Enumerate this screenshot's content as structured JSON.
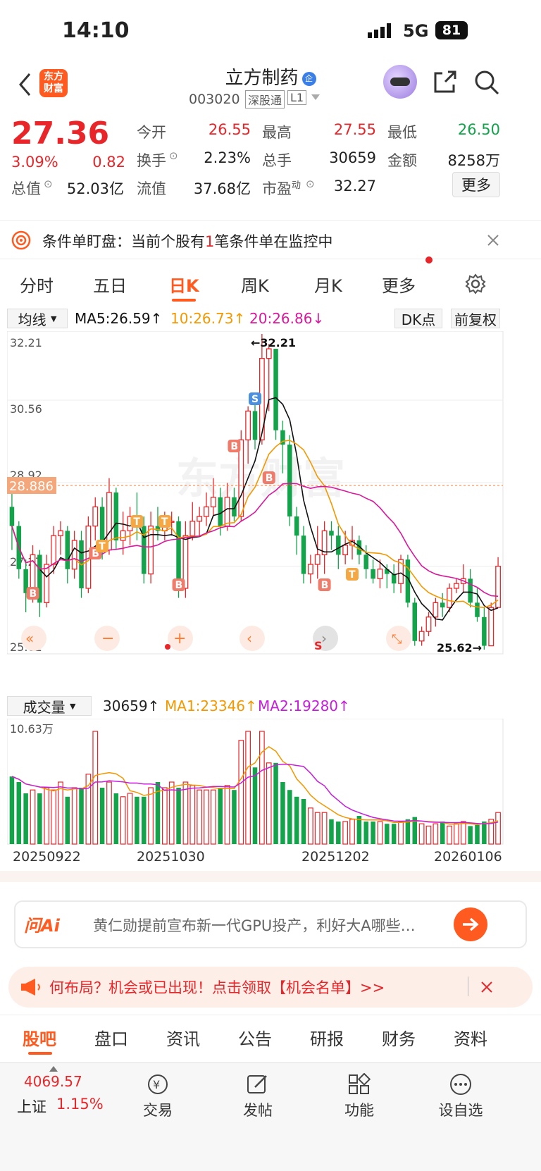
{
  "status": {
    "time": "14:10",
    "network": "5G",
    "battery": "81"
  },
  "header": {
    "title": "立方制药",
    "badge": "企",
    "code": "003020",
    "tag1": "深股通",
    "tag2": "L1",
    "logo_line1": "东方",
    "logo_line2": "财富"
  },
  "quote": {
    "price": "27.36",
    "change_pct": "3.09%",
    "change": "0.82",
    "open_label": "今开",
    "open": "26.55",
    "high_label": "最高",
    "high": "27.55",
    "low_label": "最低",
    "low": "26.50",
    "turnover_label": "换手",
    "turnover": "2.23%",
    "volume_label": "总手",
    "volume": "30659",
    "amount_label": "金额",
    "amount": "8258万",
    "mcap_label": "总值",
    "mcap": "52.03亿",
    "float_label": "流值",
    "float": "37.68亿",
    "pe_label": "市盈",
    "pe_sup": "动",
    "pe": "32.27",
    "more_label": "更多"
  },
  "condition": {
    "prefix": "条件单盯盘：当前个股有",
    "count": "1",
    "suffix": "笔条件单在监控中"
  },
  "tabs": [
    "分时",
    "五日",
    "日K",
    "周K",
    "月K",
    "更多"
  ],
  "active_tab": 2,
  "chart_toolbar": {
    "indicator": "均线",
    "ma5": "MA5:26.59",
    "ma10": "10:26.73",
    "ma20": "20:26.86",
    "dk": "DK点",
    "adjust": "前复权"
  },
  "kline_labels": {
    "ymax": "32.21",
    "y2": "30.56",
    "y3": "28.92",
    "y4": "27.27",
    "ymin": "25.62",
    "cursor_price": "28.886",
    "max_marker": "32.21",
    "min_marker": "25.62",
    "watermark": "东方财富"
  },
  "volume_toolbar": {
    "indicator": "成交量",
    "vol": "30659",
    "ma1": "MA1:23346",
    "ma2": "MA2:19280",
    "vmax": "10.63万"
  },
  "dates": [
    "20250922",
    "20251030",
    "20251202",
    "20260106"
  ],
  "ai": {
    "brand": "问Ai",
    "prompt": "黄仁勋提前宣布新一代GPU投产，利好大A哪些…"
  },
  "banner": {
    "text": "何布局？机会或已出现！点击领取【机会名单】>>"
  },
  "bottom_tabs": [
    "股吧",
    "盘口",
    "资讯",
    "公告",
    "研报",
    "财务",
    "资料"
  ],
  "dock": {
    "index_value": "4069.57",
    "index_name": "上证",
    "index_change": "1.15%",
    "trade": "交易",
    "post": "发帖",
    "func": "功能",
    "watch": "设自选"
  },
  "colors": {
    "up": "#e8262a",
    "down": "#13a34a",
    "ma5": "#111111",
    "ma10": "#f39800",
    "ma20": "#d9199b",
    "accent": "#ff5a1f"
  },
  "chart_data": {
    "type": "candlestick",
    "ylim": [
      25.62,
      32.21
    ],
    "ma_lines": {
      "MA5": 26.59,
      "MA10": 26.73,
      "MA20": 26.86
    },
    "candles": [
      [
        28.6,
        28.2,
        28.9,
        27.7
      ],
      [
        28.2,
        27.3,
        28.3,
        27.1
      ],
      [
        27.3,
        26.8,
        27.5,
        26.4
      ],
      [
        26.8,
        27.6,
        27.8,
        26.6
      ],
      [
        27.6,
        26.6,
        27.7,
        26.3
      ],
      [
        26.6,
        27.4,
        27.6,
        26.5
      ],
      [
        27.4,
        28.0,
        28.2,
        27.2
      ],
      [
        28.0,
        28.1,
        28.3,
        27.6
      ],
      [
        28.1,
        27.3,
        28.2,
        27.0
      ],
      [
        27.3,
        27.9,
        28.1,
        27.1
      ],
      [
        27.9,
        26.9,
        28.1,
        26.7
      ],
      [
        26.9,
        28.2,
        28.4,
        26.8
      ],
      [
        28.2,
        28.6,
        28.8,
        27.9
      ],
      [
        28.6,
        27.7,
        28.8,
        27.5
      ],
      [
        27.7,
        28.9,
        29.2,
        27.6
      ],
      [
        28.9,
        27.9,
        29.0,
        27.7
      ],
      [
        27.9,
        28.1,
        28.5,
        27.6
      ],
      [
        28.1,
        28.4,
        28.6,
        27.8
      ],
      [
        28.4,
        28.2,
        28.9,
        27.9
      ],
      [
        28.2,
        27.2,
        28.4,
        27.0
      ],
      [
        27.2,
        28.2,
        28.5,
        27.0
      ],
      [
        28.2,
        28.1,
        28.6,
        27.9
      ],
      [
        28.1,
        28.3,
        28.5,
        27.9
      ],
      [
        28.3,
        28.3,
        28.5,
        28.0
      ],
      [
        28.3,
        26.9,
        28.4,
        26.7
      ],
      [
        26.9,
        28.0,
        28.3,
        26.7
      ],
      [
        28.0,
        28.3,
        28.7,
        27.9
      ],
      [
        28.3,
        28.4,
        28.6,
        28.0
      ],
      [
        28.4,
        28.6,
        28.9,
        28.2
      ],
      [
        28.6,
        28.8,
        29.2,
        28.4
      ],
      [
        28.8,
        28.2,
        29.0,
        28.0
      ],
      [
        28.2,
        28.8,
        29.1,
        28.1
      ],
      [
        28.8,
        28.4,
        29.0,
        28.3
      ],
      [
        28.4,
        30.0,
        30.2,
        28.3
      ],
      [
        30.0,
        30.6,
        30.7,
        29.5
      ],
      [
        30.6,
        30.0,
        30.9,
        29.8
      ],
      [
        30.0,
        31.7,
        32.21,
        29.9
      ],
      [
        31.7,
        31.9,
        32.0,
        30.6
      ],
      [
        31.9,
        30.2,
        31.9,
        30.0
      ],
      [
        30.2,
        29.9,
        30.4,
        29.3
      ],
      [
        29.9,
        28.4,
        30.1,
        28.2
      ],
      [
        28.4,
        28.0,
        28.6,
        27.6
      ],
      [
        28.0,
        27.2,
        28.2,
        27.0
      ],
      [
        27.2,
        27.4,
        27.6,
        27.0
      ],
      [
        27.4,
        27.6,
        28.2,
        27.1
      ],
      [
        27.6,
        28.1,
        28.3,
        27.2
      ],
      [
        28.1,
        28.0,
        28.3,
        27.7
      ],
      [
        28.0,
        27.6,
        28.2,
        27.3
      ],
      [
        27.6,
        27.8,
        28.1,
        27.4
      ],
      [
        27.8,
        27.9,
        28.2,
        27.5
      ],
      [
        27.9,
        27.6,
        28.0,
        27.4
      ],
      [
        27.6,
        27.3,
        27.8,
        27.1
      ],
      [
        27.3,
        27.1,
        27.5,
        27.0
      ],
      [
        27.1,
        27.3,
        27.5,
        26.9
      ],
      [
        27.3,
        27.2,
        27.4,
        26.9
      ],
      [
        27.2,
        27.0,
        27.4,
        26.8
      ],
      [
        27.0,
        27.5,
        27.6,
        26.8
      ],
      [
        27.5,
        26.6,
        27.6,
        26.5
      ],
      [
        26.6,
        25.8,
        26.7,
        25.7
      ],
      [
        25.8,
        26.0,
        26.1,
        25.7
      ],
      [
        26.0,
        26.3,
        26.4,
        25.9
      ],
      [
        26.3,
        26.6,
        26.7,
        26.1
      ],
      [
        26.6,
        26.5,
        26.8,
        26.3
      ],
      [
        26.5,
        26.9,
        27.0,
        26.4
      ],
      [
        26.9,
        27.0,
        27.1,
        26.8
      ],
      [
        27.0,
        27.1,
        27.4,
        26.8
      ],
      [
        27.1,
        26.6,
        27.3,
        26.5
      ],
      [
        26.6,
        26.3,
        26.9,
        26.2
      ],
      [
        26.3,
        25.7,
        26.5,
        25.62
      ],
      [
        25.7,
        26.5,
        26.6,
        25.7
      ],
      [
        26.5,
        27.36,
        27.55,
        26.5
      ]
    ]
  }
}
